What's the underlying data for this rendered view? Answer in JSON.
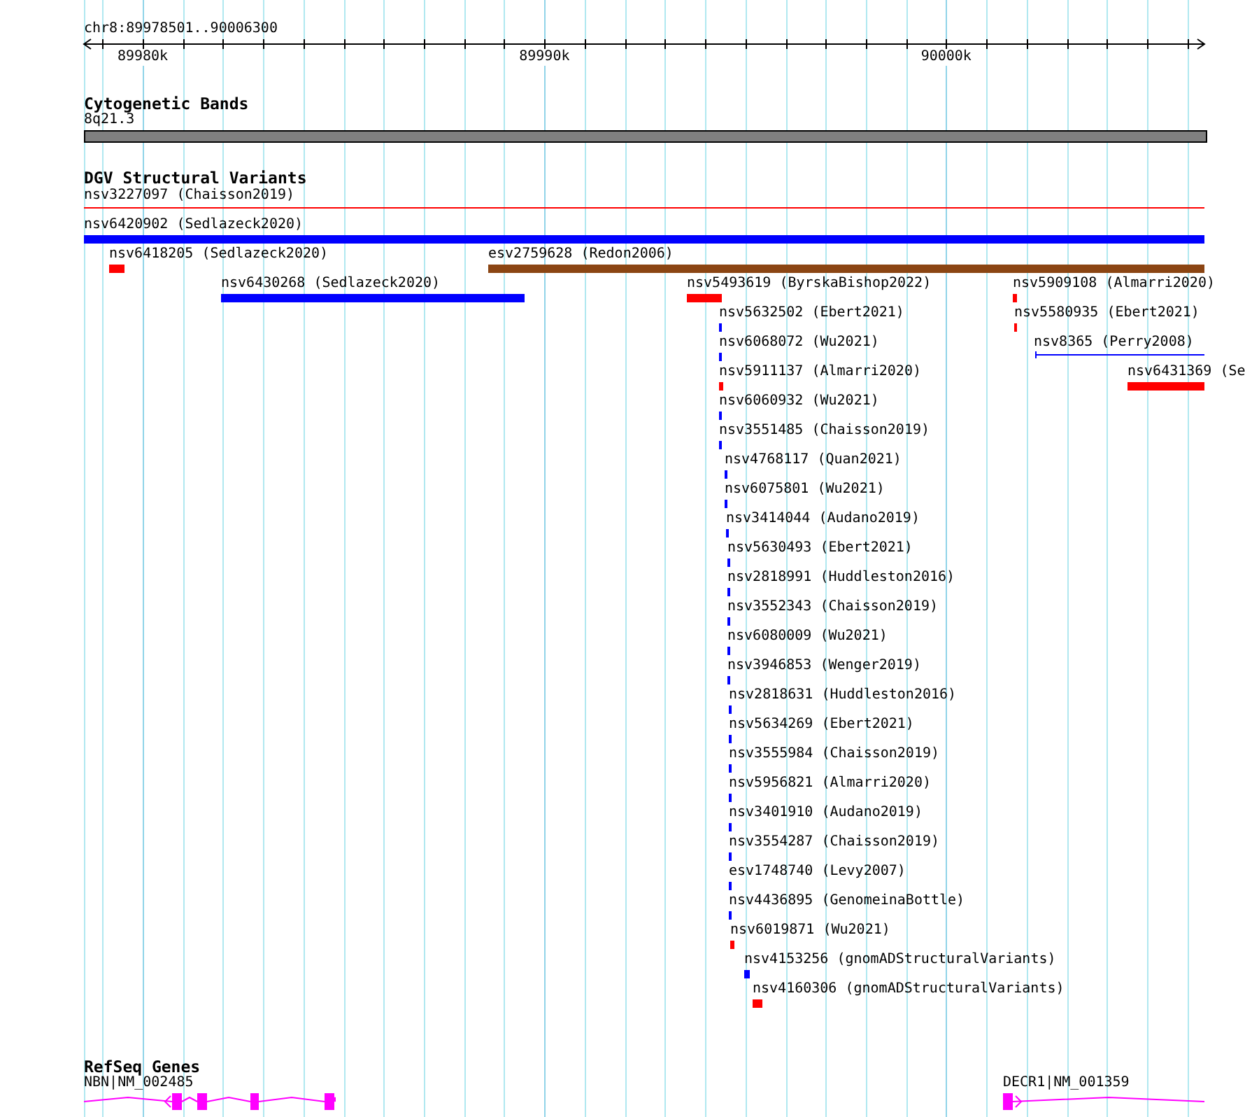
{
  "locus": "chr8:89978501..90006300",
  "ruler": {
    "ticks": [
      "89980k",
      "89990k",
      "90000k"
    ]
  },
  "cytobands": {
    "title": "Cytogenetic Bands",
    "band": "8q21.3"
  },
  "variants": {
    "title": "DGV Structural Variants",
    "features": [
      {
        "label": "nsv3227097 (Chaisson2019)",
        "color": "#ff0000",
        "kind": "line"
      },
      {
        "label": "nsv6420902 (Sedlazeck2020)",
        "color": "#0000ff",
        "kind": "bar"
      },
      {
        "label": "nsv6418205 (Sedlazeck2020)",
        "color": "#ff0000",
        "kind": "bar"
      },
      {
        "label": "esv2759628 (Redon2006)",
        "color": "#8b4513",
        "kind": "bar"
      },
      {
        "label": "nsv6430268 (Sedlazeck2020)",
        "color": "#0000ff",
        "kind": "bar"
      },
      {
        "label": "nsv5493619 (ByrskaBishop2022)",
        "color": "#ff0000",
        "kind": "bar"
      },
      {
        "label": "nsv5909108 (Almarri2020)",
        "color": "#ff0000",
        "kind": "bar"
      },
      {
        "label": "nsv5632502 (Ebert2021)",
        "color": "#0000ff",
        "kind": "bar"
      },
      {
        "label": "nsv5580935 (Ebert2021)",
        "color": "#ff0000",
        "kind": "bar"
      },
      {
        "label": "nsv6068072 (Wu2021)",
        "color": "#0000ff",
        "kind": "bar"
      },
      {
        "label": "nsv8365 (Perry2008)",
        "color": "#0000ff",
        "kind": "line"
      },
      {
        "label": "nsv5911137 (Almarri2020)",
        "color": "#ff0000",
        "kind": "bar"
      },
      {
        "label": "nsv6431369 (Se",
        "color": "#ff0000",
        "kind": "bar"
      },
      {
        "label": "nsv6060932 (Wu2021)",
        "color": "#0000ff",
        "kind": "bar"
      },
      {
        "label": "nsv3551485 (Chaisson2019)",
        "color": "#0000ff",
        "kind": "bar"
      },
      {
        "label": "nsv4768117 (Quan2021)",
        "color": "#0000ff",
        "kind": "bar"
      },
      {
        "label": "nsv6075801 (Wu2021)",
        "color": "#0000ff",
        "kind": "bar"
      },
      {
        "label": "nsv3414044 (Audano2019)",
        "color": "#0000ff",
        "kind": "bar"
      },
      {
        "label": "nsv5630493 (Ebert2021)",
        "color": "#0000ff",
        "kind": "bar"
      },
      {
        "label": "nsv2818991 (Huddleston2016)",
        "color": "#0000ff",
        "kind": "bar"
      },
      {
        "label": "nsv3552343 (Chaisson2019)",
        "color": "#0000ff",
        "kind": "bar"
      },
      {
        "label": "nsv6080009 (Wu2021)",
        "color": "#0000ff",
        "kind": "bar"
      },
      {
        "label": "nsv3946853 (Wenger2019)",
        "color": "#0000ff",
        "kind": "bar"
      },
      {
        "label": "nsv2818631 (Huddleston2016)",
        "color": "#0000ff",
        "kind": "bar"
      },
      {
        "label": "nsv5634269 (Ebert2021)",
        "color": "#0000ff",
        "kind": "bar"
      },
      {
        "label": "nsv3555984 (Chaisson2019)",
        "color": "#0000ff",
        "kind": "bar"
      },
      {
        "label": "nsv5956821 (Almarri2020)",
        "color": "#0000ff",
        "kind": "bar"
      },
      {
        "label": "nsv3401910 (Audano2019)",
        "color": "#0000ff",
        "kind": "bar"
      },
      {
        "label": "nsv3554287 (Chaisson2019)",
        "color": "#0000ff",
        "kind": "bar"
      },
      {
        "label": "esv1748740 (Levy2007)",
        "color": "#0000ff",
        "kind": "bar"
      },
      {
        "label": "nsv4436895 (GenomeinaBottle)",
        "color": "#0000ff",
        "kind": "bar"
      },
      {
        "label": "nsv6019871 (Wu2021)",
        "color": "#ff0000",
        "kind": "bar"
      },
      {
        "label": "nsv4153256 (gnomADStructuralVariants)",
        "color": "#0000ff",
        "kind": "bar"
      },
      {
        "label": "nsv4160306 (gnomADStructuralVariants)",
        "color": "#ff0000",
        "kind": "bar"
      }
    ]
  },
  "genes": {
    "title": "RefSeq Genes",
    "items": [
      {
        "label": "NBN|NM_002485",
        "kind": "reverse"
      },
      {
        "label": "DECR1|NM_001359",
        "kind": "forward"
      }
    ]
  }
}
